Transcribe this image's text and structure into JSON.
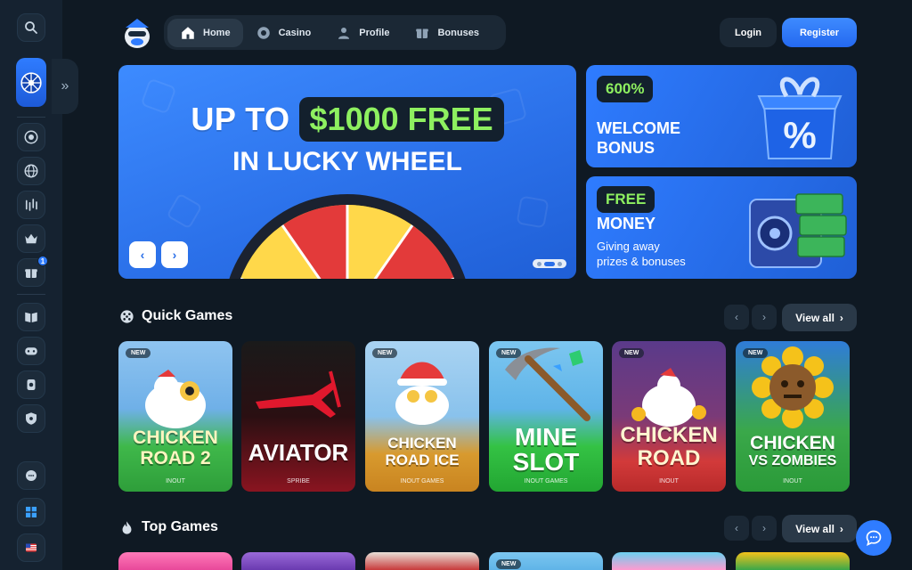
{
  "nav": {
    "items": [
      {
        "label": "Home",
        "icon": "home-icon"
      },
      {
        "label": "Casino",
        "icon": "chip-icon"
      },
      {
        "label": "Profile",
        "icon": "user-icon"
      },
      {
        "label": "Bonuses",
        "icon": "gift-icon"
      }
    ],
    "login_label": "Login",
    "register_label": "Register"
  },
  "sidebar": {
    "expand_glyph": "»",
    "bonus_badge": "1"
  },
  "hero": {
    "line1_prefix": "UP TO",
    "line1_highlight": "$1000 FREE",
    "line2": "IN LUCKY WHEEL",
    "prev": "‹",
    "next": "›"
  },
  "promos": [
    {
      "tag": "600%",
      "title_line1": "WELCOME",
      "title_line2": "BONUS"
    },
    {
      "tag": "FREE",
      "title": "MONEY",
      "sub_line1": "Giving away",
      "sub_line2": "prizes & bonuses"
    }
  ],
  "sections": {
    "quick_games": {
      "title": "Quick Games",
      "view_all": "View all"
    },
    "top_games": {
      "title": "Top Games",
      "view_all": "View all"
    }
  },
  "games": [
    {
      "name1": "CHICKEN",
      "name2": "ROAD 2",
      "provider": "INOUT",
      "new": "NEW"
    },
    {
      "name1": "AVIATOR",
      "name2": "",
      "provider": "SPRIBE",
      "new": ""
    },
    {
      "name1": "CHICKEN",
      "name2": "ROAD ICE",
      "provider": "INOUT GAMES",
      "new": "NEW"
    },
    {
      "name1": "MINE",
      "name2": "SLOT",
      "provider": "INOUT GAMES",
      "new": "NEW"
    },
    {
      "name1": "CHICKEN",
      "name2": "ROAD",
      "provider": "INOUT",
      "new": "NEW"
    },
    {
      "name1": "CHICKEN",
      "name2": "VS ZOMBIES",
      "provider": "INOUT",
      "new": "NEW"
    }
  ],
  "top_games_new": "NEW",
  "colors": {
    "accent": "#2f7cff",
    "green_text": "#8ef060",
    "bg": "#0f1923"
  }
}
